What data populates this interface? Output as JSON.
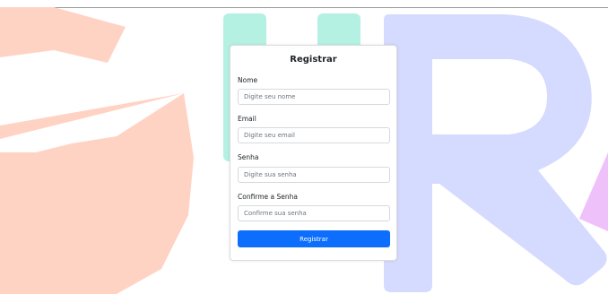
{
  "colors": {
    "background_letter_g": "#ffd3c4",
    "background_letter_u": "#b4f1e2",
    "background_letter_r": "#d5daff",
    "background_letter_accent": "#efc1fb",
    "primary_button": "#0d6efd"
  },
  "form": {
    "title": "Registrar",
    "fields": [
      {
        "label": "Nome",
        "placeholder": "Digite seu nome",
        "type": "text"
      },
      {
        "label": "Email",
        "placeholder": "Digite seu email",
        "type": "email"
      },
      {
        "label": "Senha",
        "placeholder": "Digite sua senha",
        "type": "password"
      },
      {
        "label": "Confirme a Senha",
        "placeholder": "Confirme sua senha",
        "type": "password"
      }
    ],
    "submit_label": "Registrar"
  }
}
